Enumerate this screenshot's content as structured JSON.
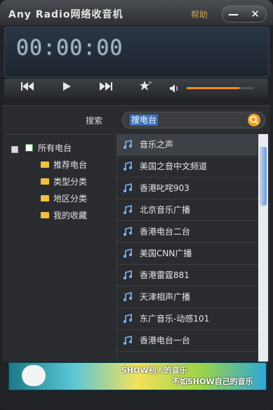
{
  "app": {
    "title": "Any Radio网络收音机",
    "help_label": "帮助",
    "minimize_label": "—",
    "close_label": "✕"
  },
  "player": {
    "time": "00:00:00",
    "volume_level_percent": 78
  },
  "search": {
    "label": "搜索",
    "query": "搜电台"
  },
  "tree": {
    "root_label": "所有电台",
    "items": [
      {
        "label": "推荐电台",
        "icon": "folder-open-icon"
      },
      {
        "label": "类型分类",
        "icon": "folder-icon"
      },
      {
        "label": "地区分类",
        "icon": "folder-icon"
      },
      {
        "label": "我的收藏",
        "icon": "folder-icon"
      }
    ]
  },
  "stations": [
    {
      "name": "音乐之声",
      "selected": true
    },
    {
      "name": "美国之音中文频道",
      "selected": false
    },
    {
      "name": "香港叱咤903",
      "selected": false
    },
    {
      "name": "北京音乐广播",
      "selected": false
    },
    {
      "name": "香港电台二台",
      "selected": false
    },
    {
      "name": "美国CNN广播",
      "selected": false
    },
    {
      "name": "香港雷霆881",
      "selected": false
    },
    {
      "name": "天津相声广播",
      "selected": false
    },
    {
      "name": "东广音乐-动感101",
      "selected": false
    },
    {
      "name": "香港电台一台",
      "selected": false
    }
  ],
  "ad": {
    "text_top": "SHOW别人的音乐",
    "text_bottom": "不如SHOW自己的音乐"
  },
  "colors": {
    "accent": "#f08a24",
    "help": "#c9a548",
    "display_text": "#9fb2c4"
  }
}
